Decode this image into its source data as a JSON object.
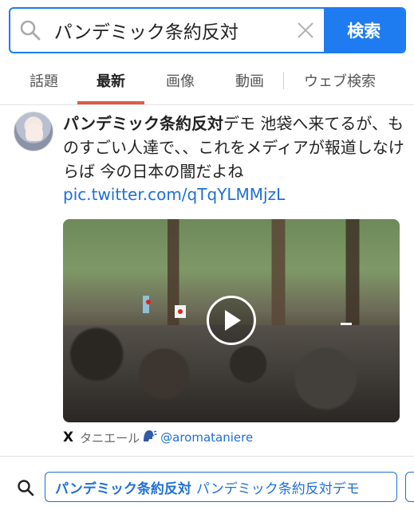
{
  "search": {
    "query": "パンデミック条約反対",
    "button_label": "検索",
    "icon": "search-icon",
    "clear_icon": "close-icon"
  },
  "tabs": [
    {
      "label": "話題",
      "active": false
    },
    {
      "label": "最新",
      "active": true
    },
    {
      "label": "画像",
      "active": false
    },
    {
      "label": "動画",
      "active": false
    },
    {
      "label": "ウェブ検索",
      "active": false
    }
  ],
  "post": {
    "highlight": "パンデミック条約反対",
    "text": "デモ 池袋へ来てるが、ものすごい人達で、、これをメディアが報道しなけらば 今の日本の闇だよね",
    "link": "pic.twitter.com/qTqYLMMjzL",
    "source_logo": "X",
    "author_name": "タニエール",
    "author_icon": "speaking-head-icon",
    "author_handle": "@aromataniere"
  },
  "related": {
    "highlight": "パンデミック条約反対",
    "text": "パンデミック条約反対デモ"
  },
  "colors": {
    "accent": "#1e7cf0",
    "active_tab_underline": "#e05a47",
    "link": "#1e6fd6"
  }
}
